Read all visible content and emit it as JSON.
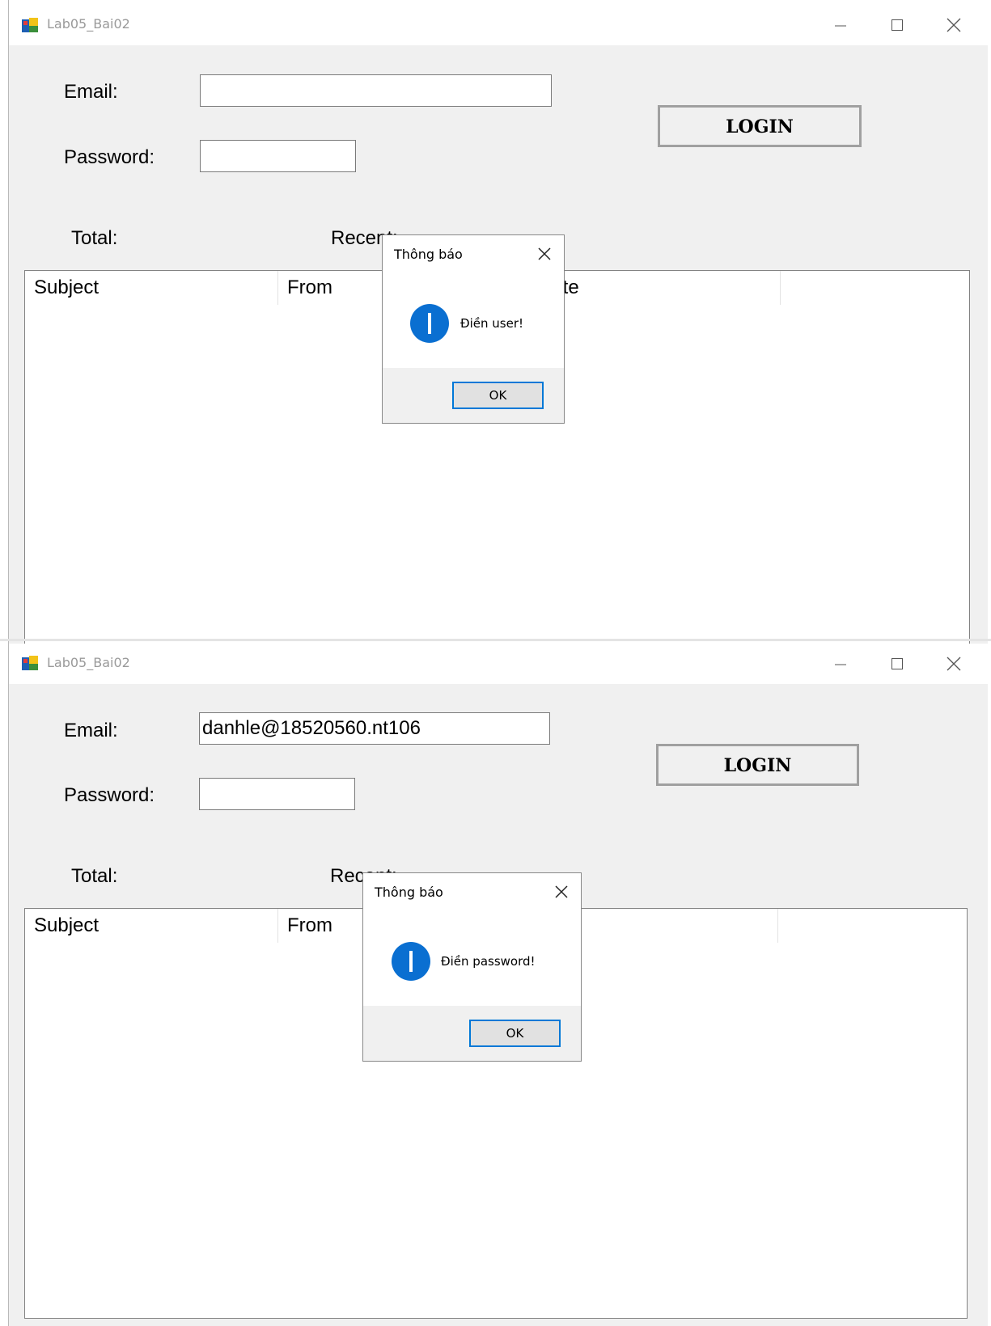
{
  "windows": [
    {
      "title": "Lab05_Bai02",
      "form": {
        "email_label": "Email:",
        "email_value": "",
        "password_label": "Password:",
        "password_value": "",
        "login_label": "LOGIN",
        "total_label": "Total:",
        "recent_label": "Recent:"
      },
      "listview": {
        "columns": [
          "Subject",
          "From",
          "Date",
          ""
        ]
      },
      "dialog": {
        "title": "Thông báo",
        "icon": "info-icon",
        "message": "Điền user!",
        "ok_label": "OK"
      }
    },
    {
      "title": "Lab05_Bai02",
      "form": {
        "email_label": "Email:",
        "email_value": "danhle@18520560.nt106",
        "password_label": "Password:",
        "password_value": "",
        "login_label": "LOGIN",
        "total_label": "Total:",
        "recent_label": "Recent:"
      },
      "listview": {
        "columns": [
          "Subject",
          "From",
          "Date",
          ""
        ]
      },
      "dialog": {
        "title": "Thông báo",
        "icon": "info-icon",
        "message": "Điền password!",
        "ok_label": "OK"
      }
    }
  ],
  "colors": {
    "form_background": "#f0f0f0",
    "info_icon": "#0a6fd1",
    "ok_border": "#0078d7"
  }
}
